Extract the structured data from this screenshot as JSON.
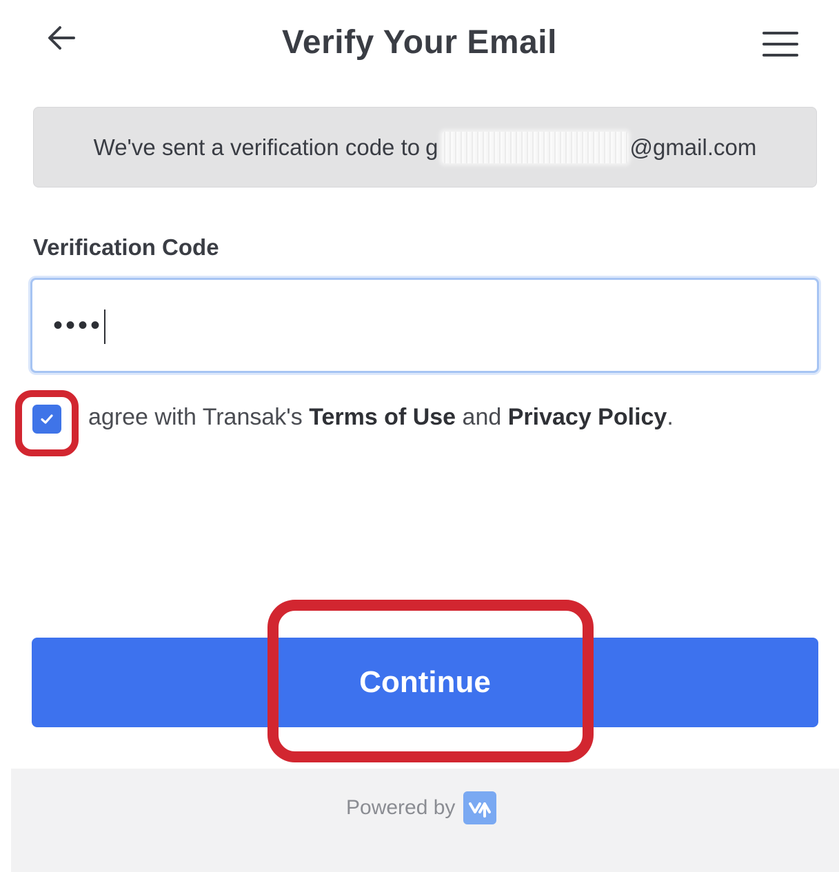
{
  "header": {
    "title": "Verify Your Email",
    "back_icon": "arrow-left-icon",
    "menu_icon": "hamburger-menu-icon"
  },
  "banner": {
    "text_prefix": "We've sent a verification code to",
    "email_visible_prefix": "g",
    "email_suffix": "@gmail.com"
  },
  "form": {
    "code_label": "Verification Code",
    "code_value_masked": "••••",
    "agree_prefix": "agree with Transak's",
    "terms_label": "Terms of Use",
    "and_text": "and",
    "privacy_label": "Privacy Policy",
    "period": ".",
    "checkbox_checked": true
  },
  "actions": {
    "continue_label": "Continue"
  },
  "footer": {
    "powered_by": "Powered by",
    "brand_icon": "transak-logo-icon"
  },
  "colors": {
    "primary": "#3d72ee",
    "highlight": "#d22630",
    "banner_bg": "#e3e3e4",
    "text_dark": "#3a3d44"
  }
}
